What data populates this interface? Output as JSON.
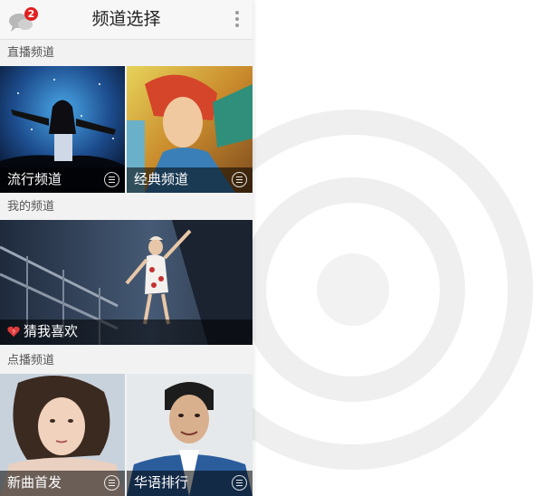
{
  "header": {
    "title": "频道选择",
    "message_badge": "2"
  },
  "sections": {
    "live": {
      "label": "直播频道"
    },
    "mine": {
      "label": "我的频道"
    },
    "ondemand": {
      "label": "点播频道"
    }
  },
  "channels": {
    "pop": {
      "label": "流行频道"
    },
    "classic": {
      "label": "经典频道"
    },
    "guess": {
      "label": "猜我喜欢"
    },
    "newsongs": {
      "label": "新曲首发"
    },
    "chinese_chart": {
      "label": "华语排行"
    }
  },
  "colors": {
    "badge": "#e02020",
    "heart": "#e03a3a",
    "panel_bg": "#f2f2f2",
    "ring": "#f0f0f0"
  },
  "icons": [
    "chat-bubble-icon",
    "more-vertical-icon",
    "list-icon",
    "heart-icon",
    "radio-rings-icon"
  ]
}
